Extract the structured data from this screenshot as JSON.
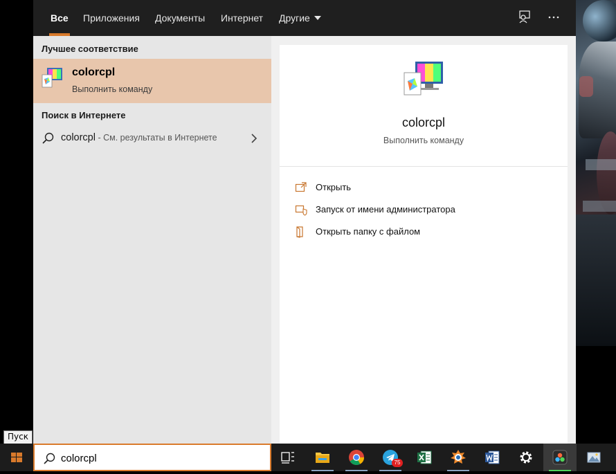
{
  "tooltip": "Пуск",
  "nav": {
    "tabs": [
      {
        "label": "Все",
        "active": true
      },
      {
        "label": "Приложения"
      },
      {
        "label": "Документы"
      },
      {
        "label": "Интернет"
      },
      {
        "label": "Другие"
      }
    ],
    "icons": [
      "feedback-icon",
      "more-icon"
    ]
  },
  "results": {
    "best_match_title": "Лучшее соответствие",
    "best_match": {
      "name": "colorcpl",
      "type": "Выполнить команду",
      "icon": "color-management-icon"
    },
    "web_title": "Поиск в Интернете",
    "web_item": {
      "query": "colorcpl",
      "suffix": " - См. результаты в Интернете"
    }
  },
  "detail": {
    "name": "colorcpl",
    "type": "Выполнить команду",
    "actions": [
      {
        "label": "Открыть",
        "icon": "open-icon"
      },
      {
        "label": "Запуск от имени администратора",
        "icon": "admin-shield-icon"
      },
      {
        "label": "Открыть папку с файлом",
        "icon": "folder-open-icon"
      }
    ]
  },
  "search": {
    "value": "colorcpl"
  },
  "taskbar": {
    "apps": [
      "task-view",
      "file-explorer",
      "chrome",
      "telegram",
      "excel",
      "photo-app",
      "word",
      "settings",
      "davinci-resolve",
      "image-viewer"
    ],
    "telegram_badge": "75"
  },
  "colors": {
    "accent": "#d97a2b",
    "highlight": "#e8c6ac",
    "taskbar": "#1c1c1c",
    "nav": "#1f1f1f"
  }
}
